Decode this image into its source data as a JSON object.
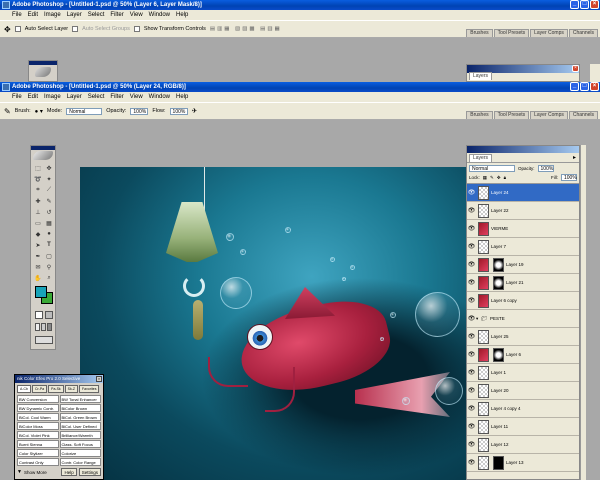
{
  "back_window": {
    "title": "Adobe Photoshop - [Untitled-1.psd @ 50% (Layer 6, Layer Mask/8)]",
    "menu": [
      "File",
      "Edit",
      "Image",
      "Layer",
      "Select",
      "Filter",
      "View",
      "Window",
      "Help"
    ],
    "options": {
      "auto_select_layer": "Auto Select Layer",
      "auto_select_groups": "Auto Select Groups",
      "show_transform": "Show Transform Controls"
    },
    "dock_tabs": [
      "Brushes",
      "Tool Presets",
      "Layer Comps",
      "Channels"
    ],
    "layers_tab": "Layers"
  },
  "front_window": {
    "title": "Adobe Photoshop - [Untitled-1.psd @ 50% (Layer 24, RGB/8)]",
    "menu": [
      "File",
      "Edit",
      "Image",
      "Layer",
      "Select",
      "Filter",
      "View",
      "Window",
      "Help"
    ],
    "options": {
      "brush_label": "Brush:",
      "mode_label": "Mode:",
      "mode_value": "Normal",
      "opacity_label": "Opacity:",
      "opacity_value": "100%",
      "flow_label": "Flow:",
      "flow_value": "100%"
    },
    "dock_tabs": [
      "Brushes",
      "Tool Presets",
      "Layer Comps",
      "Channels"
    ]
  },
  "layers_panel": {
    "tab": "Layers",
    "blend_mode": "Normal",
    "opacity_label": "Opacity:",
    "opacity_value": "100%",
    "lock_label": "Lock:",
    "fill_label": "Fill:",
    "fill_value": "100%",
    "rows": [
      {
        "name": "Layer 24",
        "thumb": "checker",
        "selected": true
      },
      {
        "name": "Layer 22",
        "thumb": "checker"
      },
      {
        "name": "VIERME",
        "thumb": "red"
      },
      {
        "name": "Layer 7",
        "thumb": "checker"
      },
      {
        "name": "Layer 19",
        "thumb": "red",
        "mask": "maskw"
      },
      {
        "name": "Layer 21",
        "thumb": "red",
        "mask": "maskw"
      },
      {
        "name": "Layer 6 copy",
        "thumb": "red"
      },
      {
        "name": "PESTE",
        "thumb": "folder"
      },
      {
        "name": "Layer 25",
        "thumb": "checker"
      },
      {
        "name": "Layer 6",
        "thumb": "red",
        "mask": "maskw"
      },
      {
        "name": "Layer 1",
        "thumb": "checker"
      },
      {
        "name": "Layer 20",
        "thumb": "checker"
      },
      {
        "name": "Layer 4 copy 4",
        "thumb": "checker"
      },
      {
        "name": "Layer 11",
        "thumb": "checker"
      },
      {
        "name": "Layer 12",
        "thumb": "checker"
      },
      {
        "name": "Layer 13",
        "thumb": "checker",
        "mask": "mask"
      }
    ]
  },
  "nik_panel": {
    "title": "nik Color Efex Pro 2.0 Selective",
    "tabs": [
      "A-Cb",
      "Cr-Pa",
      "Pa-Sk",
      "Sk-Z",
      "Favorites"
    ],
    "filters": [
      "BW Conversion",
      "BW Tonal Enhancer",
      "BW Dynamic Contr.",
      "BiColor Brown",
      "BiCol. Cool Warm",
      "BiCol. Green Brown",
      "BiColor Moss",
      "BiCol. User Defined",
      "BiCol. Violet Pink",
      "Brilliance/Warmth",
      "Burnt Sienna",
      "Class. Soft Focus",
      "Color Stylizer",
      "Colorize",
      "Contrast Only",
      "Contr. Color Range"
    ],
    "show_more": "Show More",
    "help": "Help",
    "settings": "Settings"
  },
  "colors": {
    "accent": "#316ac5",
    "title_blue": "#0043b3",
    "foreground_swatch": "#18a3b8",
    "background_swatch": "#39a835"
  }
}
